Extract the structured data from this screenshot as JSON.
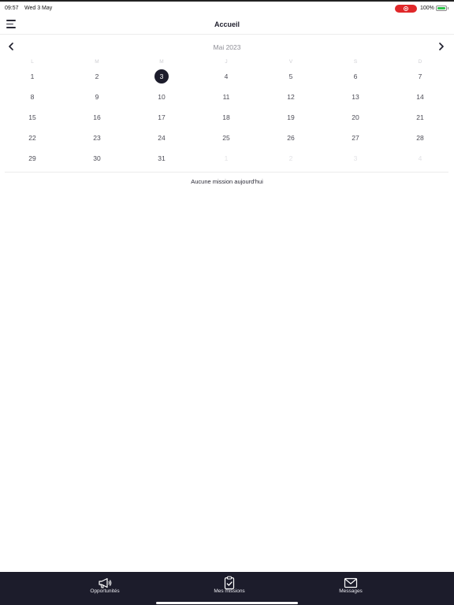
{
  "status": {
    "time": "09:57",
    "date": "Wed 3 May",
    "battery_pct": "100%",
    "battery_level": 1.0,
    "recording_color": "#e0282a"
  },
  "header": {
    "title": "Accueil",
    "menu_icon": "hamburger-menu-icon"
  },
  "calendar": {
    "month_label": "Mai 2023",
    "prev_icon": "chevron-left-icon",
    "next_icon": "chevron-right-icon",
    "weekdays": [
      "L",
      "M",
      "M",
      "J",
      "V",
      "S",
      "D"
    ],
    "weeks": [
      [
        "1",
        "2",
        "3",
        "4",
        "5",
        "6",
        "7"
      ],
      [
        "8",
        "9",
        "10",
        "11",
        "12",
        "13",
        "14"
      ],
      [
        "15",
        "16",
        "17",
        "18",
        "19",
        "20",
        "21"
      ],
      [
        "22",
        "23",
        "24",
        "25",
        "26",
        "27",
        "28"
      ],
      [
        "29",
        "30",
        "31",
        "1",
        "2",
        "3",
        "4"
      ]
    ],
    "selected_day": "3",
    "accent_color": "#1c1c2b"
  },
  "main": {
    "empty_message": "Aucune mission aujourd'hui"
  },
  "tabs": [
    {
      "label": "Opportunités",
      "icon": "megaphone-icon"
    },
    {
      "label": "Mes missions",
      "icon": "clipboard-check-icon"
    },
    {
      "label": "Messages",
      "icon": "envelope-icon"
    }
  ]
}
